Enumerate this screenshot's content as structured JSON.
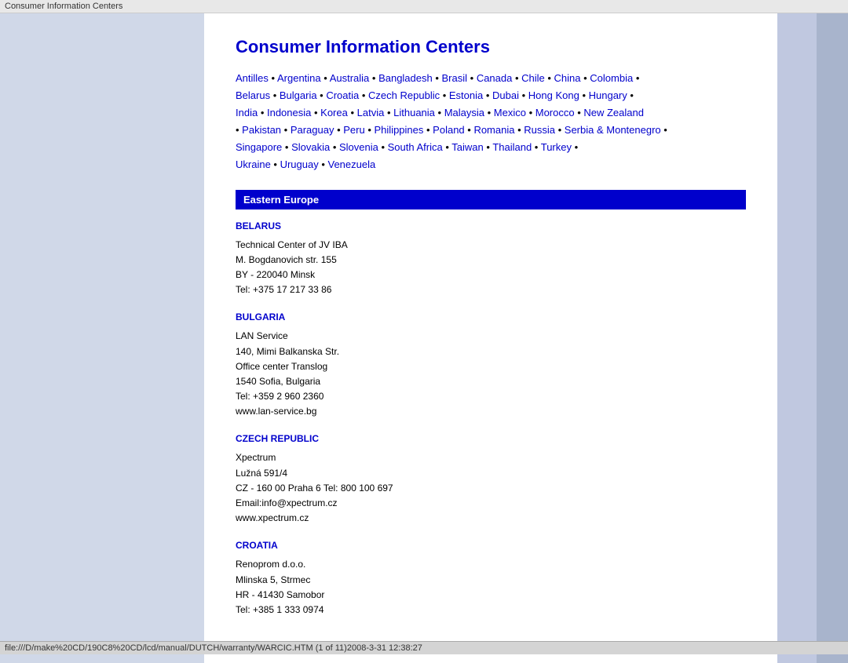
{
  "titleBar": "Consumer Information Centers",
  "pageTitle": "Consumer Information Centers",
  "navLinks": [
    "Antilles",
    "Argentina",
    "Australia",
    "Bangladesh",
    "Brasil",
    "Canada",
    "Chile",
    "China",
    "Colombia",
    "Belarus",
    "Bulgaria",
    "Croatia",
    "Czech Republic",
    "Estonia",
    "Dubai",
    "Hong Kong",
    "Hungary",
    "India",
    "Indonesia",
    "Korea",
    "Latvia",
    "Lithuania",
    "Malaysia",
    "Mexico",
    "Morocco",
    "New Zealand",
    "Pakistan",
    "Paraguay",
    "Peru",
    "Philippines",
    "Poland",
    "Romania",
    "Russia",
    "Serbia & Montenegro",
    "Singapore",
    "Slovakia",
    "Slovenia",
    "South Africa",
    "Taiwan",
    "Thailand",
    "Turkey",
    "Ukraine",
    "Uruguay",
    "Venezuela"
  ],
  "sectionHeader": "Eastern Europe",
  "countries": [
    {
      "name": "BELARUS",
      "info": "Technical Center of JV IBA\nM. Bogdanovich str. 155\nBY - 220040 Minsk\nTel: +375 17 217 33 86"
    },
    {
      "name": "BULGARIA",
      "info": "LAN Service\n140, Mimi Balkanska Str.\nOffice center Translog\n1540 Sofia, Bulgaria\nTel: +359 2 960 2360\nwww.lan-service.bg"
    },
    {
      "name": "CZECH REPUBLIC",
      "info": "Xpectrum\nLužná 591/4\nCZ - 160 00 Praha 6 Tel: 800 100 697\nEmail:info@xpectrum.cz\nwww.xpectrum.cz"
    },
    {
      "name": "CROATIA",
      "info": "Renoprom d.o.o.\nMlinska 5, Strmec\nHR - 41430 Samobor\nTel: +385 1 333 0974"
    }
  ],
  "statusBar": "file:///D/make%20CD/190C8%20CD/lcd/manual/DUTCH/warranty/WARCIC.HTM (1 of 11)2008-3-31 12:38:27"
}
